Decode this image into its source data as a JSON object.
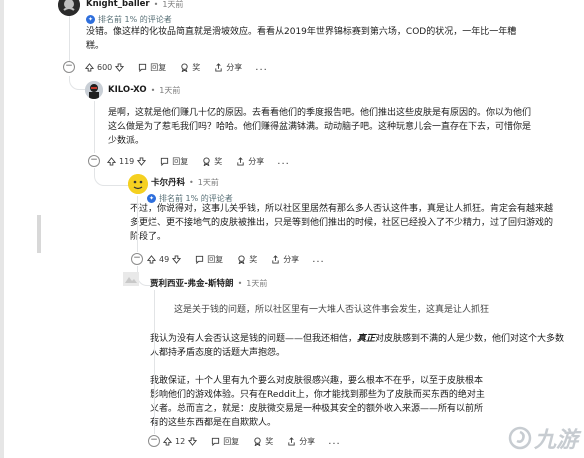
{
  "comments": [
    {
      "username": "Knight_baller",
      "dot": "•",
      "time": "1天前",
      "badge": "排名前 1% 的评论者",
      "body": "没错。像这样的化妆品简直就是滑坡效应。看看从2019年世界锦标赛到第六场，COD的状况，一年比一年糟糕。",
      "votes": "600",
      "reply": "回复",
      "award": "奖",
      "share": "分享",
      "more": "..."
    },
    {
      "username": "KILO-XO",
      "dot": "•",
      "time": "1天前",
      "body": "是啊，这就是他们赚几十亿的原因。去看看他们的季度报告吧。他们推出这些皮肤是有原因的。你以为他们这么做是为了惹毛我们吗？哈哈。他们赚得盆满钵满。动动脑子吧。这种玩意儿会一直存在下去，可惜你是少数派。",
      "votes": "119",
      "reply": "回复",
      "award": "奖",
      "share": "分享",
      "more": "..."
    },
    {
      "username": "卡尔丹科",
      "dot": "•",
      "time": "1天前",
      "badge": "排名前 1% 的评论者",
      "body": "不过，你说得对，这事儿关乎钱，所以社区里居然有那么多人否认这件事，真是让人抓狂。肯定会有越来越多更烂、更不接地气的皮肤被推出，只是等到他们推出的时候，社区已经投入了不少精力，过了回归游戏的阶段了。",
      "votes": "49",
      "reply": "回复",
      "award": "奖",
      "share": "分享",
      "more": "..."
    },
    {
      "username": "贾利西亚-弗金-斯特朗",
      "dot": "•",
      "time": "1天前",
      "quote": "这是关于钱的问题，所以社区里有一大堆人否认这件事会发生，这真是让人抓狂",
      "body1_pre": "我认为没有人会否认这是钱的问题——但我还相信，",
      "body1_em": "真正",
      "body1_post": "对皮肤感到不满的人是少数，他们对这个大多数人都持矛盾态度的话题大声抱怨。",
      "body2": "我敢保证，十个人里有九个要么对皮肤很感兴趣，要么根本不在乎，以至于皮肤根本影响他们的游戏体验。只有在Reddit上，你才能找到那些为了皮肤而买东西的绝对主义者。总而言之，就是：皮肤微交易是一种极其安全的额外收入来源——所有以前所有的这些东西都是在自欺欺人。",
      "votes": "12",
      "reply": "回复",
      "award": "奖",
      "share": "分享",
      "more": "..."
    }
  ],
  "watermark": "九游",
  "colors": {
    "badge": "#2f6fdc",
    "text": "#1c1c1c",
    "meta": "#7c7c7c",
    "line": "#e2e4e6"
  }
}
